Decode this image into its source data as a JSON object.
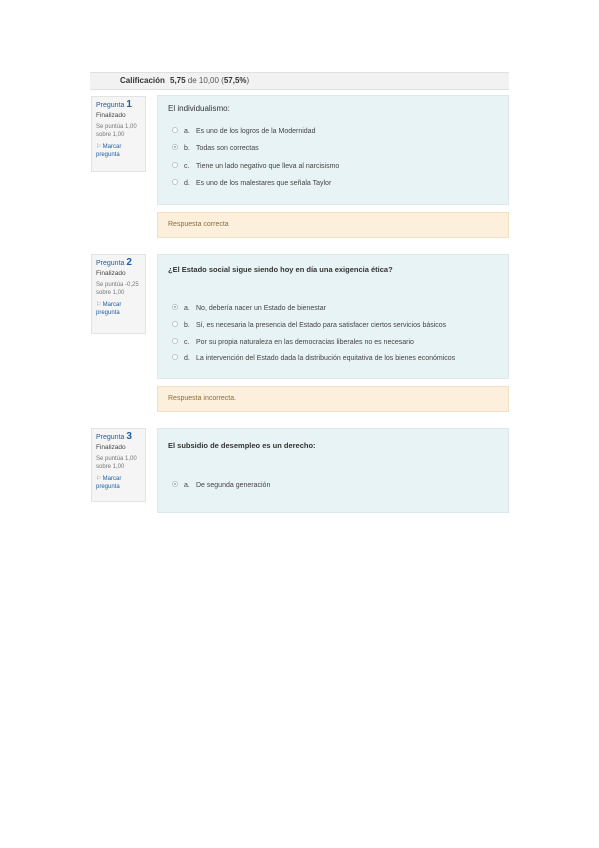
{
  "grade": {
    "label": "Calificación",
    "score": "5,75",
    "rest": " de 10,00 (",
    "percent": "57,5%",
    "close": ")"
  },
  "questions": [
    {
      "label": "Pregunta",
      "number": "1",
      "state": "Finalizado",
      "grade": "Se puntúa 1,00 sobre 1,00",
      "flag": "Marcar pregunta",
      "text": "El individualismo:",
      "options": [
        {
          "letter": "a.",
          "text": "Es uno de los logros de la Modernidad",
          "checked": false
        },
        {
          "letter": "b.",
          "text": "Todas son correctas",
          "checked": true
        },
        {
          "letter": "c.",
          "text": "Tiene un lado negativo que lleva al narcisismo",
          "checked": false
        },
        {
          "letter": "d.",
          "text": "Es uno de los malestares que señala Taylor",
          "checked": false
        }
      ],
      "feedback": "Respuesta correcta"
    },
    {
      "label": "Pregunta",
      "number": "2",
      "state": "Finalizado",
      "grade": "Se puntúa -0,25 sobre 1,00",
      "flag": "Marcar pregunta",
      "text": "¿El Estado social sigue siendo hoy en día una exigencia ética?",
      "options": [
        {
          "letter": "a.",
          "text": "No, debería nacer un Estado de bienestar",
          "checked": true
        },
        {
          "letter": "b.",
          "text": "Sí, es necesaria la presencia del Estado para satisfacer ciertos servicios básicos",
          "checked": false
        },
        {
          "letter": "c.",
          "text": "Por su propia naturaleza en las democracias liberales no es necesario",
          "checked": false
        },
        {
          "letter": "d.",
          "text": "La intervención del Estado dada la distribución equitativa de los bienes económicos",
          "checked": false
        }
      ],
      "feedback": "Respuesta incorrecta."
    },
    {
      "label": "Pregunta",
      "number": "3",
      "state": "Finalizado",
      "grade": "Se puntúa 1,00 sobre 1,00",
      "flag": "Marcar pregunta",
      "text": "El subsidio de desempleo es un derecho:",
      "options": [
        {
          "letter": "a.",
          "text": "De segunda generación",
          "checked": true
        }
      ]
    }
  ]
}
